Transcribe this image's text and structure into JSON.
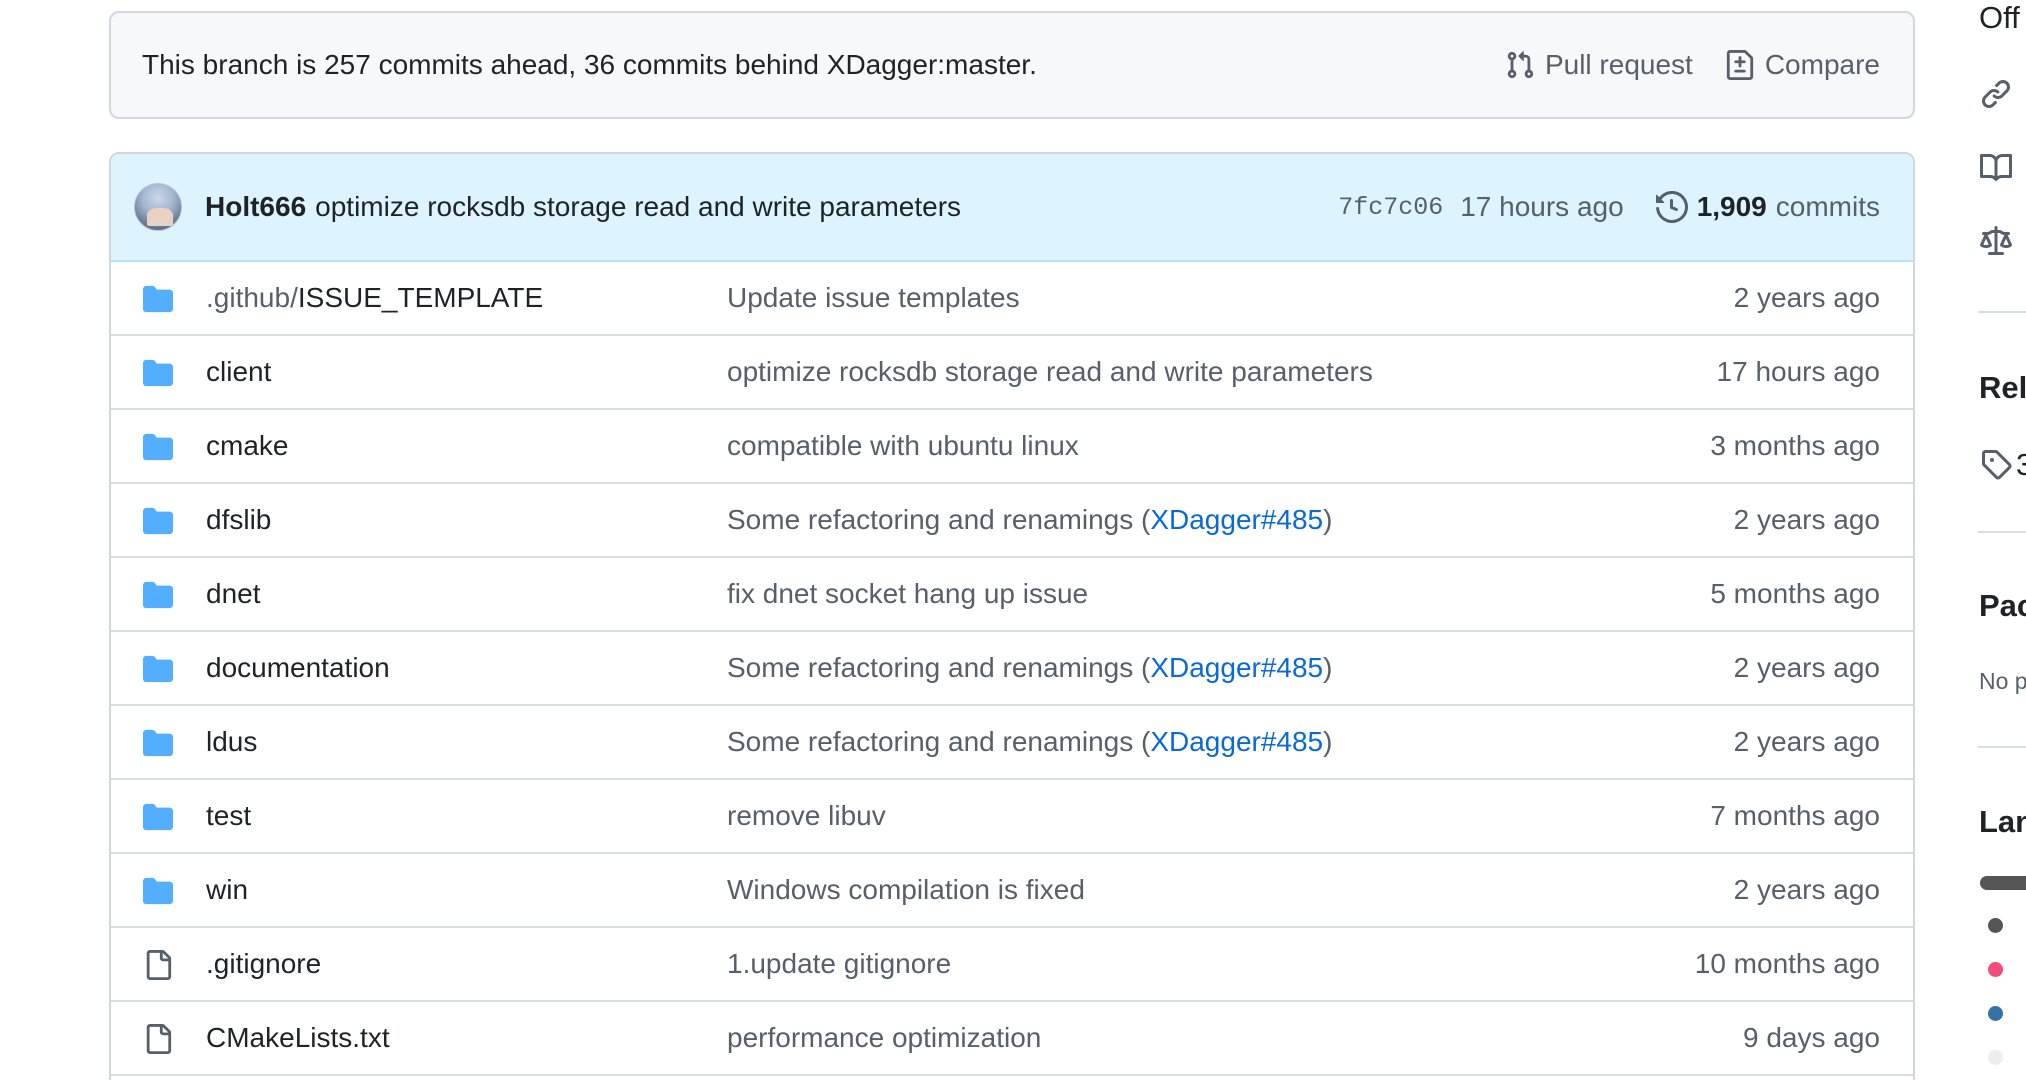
{
  "branch_info": {
    "text": "This branch is 257 commits ahead, 36 commits behind XDagger:master.",
    "pull_request_label": "Pull request",
    "compare_label": "Compare"
  },
  "latest_commit": {
    "author": "Holt666",
    "message": "optimize rocksdb storage read and write parameters",
    "sha": "7fc7c06",
    "time": "17 hours ago",
    "count": "1,909",
    "count_label": "commits"
  },
  "files": [
    {
      "type": "folder",
      "name_prefix": ".github/",
      "name": "ISSUE_TEMPLATE",
      "message": "Update issue templates",
      "link": "",
      "message_suffix": "",
      "age": "2 years ago"
    },
    {
      "type": "folder",
      "name_prefix": "",
      "name": "client",
      "message": "optimize rocksdb storage read and write parameters",
      "link": "",
      "message_suffix": "",
      "age": "17 hours ago"
    },
    {
      "type": "folder",
      "name_prefix": "",
      "name": "cmake",
      "message": "compatible with ubuntu linux",
      "link": "",
      "message_suffix": "",
      "age": "3 months ago"
    },
    {
      "type": "folder",
      "name_prefix": "",
      "name": "dfslib",
      "message": "Some refactoring and renamings (",
      "link": "XDagger#485",
      "message_suffix": ")",
      "age": "2 years ago"
    },
    {
      "type": "folder",
      "name_prefix": "",
      "name": "dnet",
      "message": "fix dnet socket hang up issue",
      "link": "",
      "message_suffix": "",
      "age": "5 months ago"
    },
    {
      "type": "folder",
      "name_prefix": "",
      "name": "documentation",
      "message": "Some refactoring and renamings (",
      "link": "XDagger#485",
      "message_suffix": ")",
      "age": "2 years ago"
    },
    {
      "type": "folder",
      "name_prefix": "",
      "name": "ldus",
      "message": "Some refactoring and renamings (",
      "link": "XDagger#485",
      "message_suffix": ")",
      "age": "2 years ago"
    },
    {
      "type": "folder",
      "name_prefix": "",
      "name": "test",
      "message": "remove libuv",
      "link": "",
      "message_suffix": "",
      "age": "7 months ago"
    },
    {
      "type": "folder",
      "name_prefix": "",
      "name": "win",
      "message": "Windows compilation is fixed",
      "link": "",
      "message_suffix": "",
      "age": "2 years ago"
    },
    {
      "type": "file",
      "name_prefix": "",
      "name": ".gitignore",
      "message": "1.update gitignore",
      "link": "",
      "message_suffix": "",
      "age": "10 months ago"
    },
    {
      "type": "file",
      "name_prefix": "",
      "name": "CMakeLists.txt",
      "message": "performance optimization",
      "link": "",
      "message_suffix": "",
      "age": "9 days ago"
    }
  ],
  "sidebar": {
    "top_text": "Off",
    "releases_heading": "Rel",
    "releases_count": "3",
    "packages_heading": "Pac",
    "packages_text": "No p",
    "languages_heading": "Lan",
    "language_colors": [
      "#555555",
      "#f34b7d",
      "#3572A5",
      "#ededed"
    ]
  },
  "colors": {
    "folder": "#54aeff",
    "link": "#0969da",
    "muted": "#57606a"
  }
}
